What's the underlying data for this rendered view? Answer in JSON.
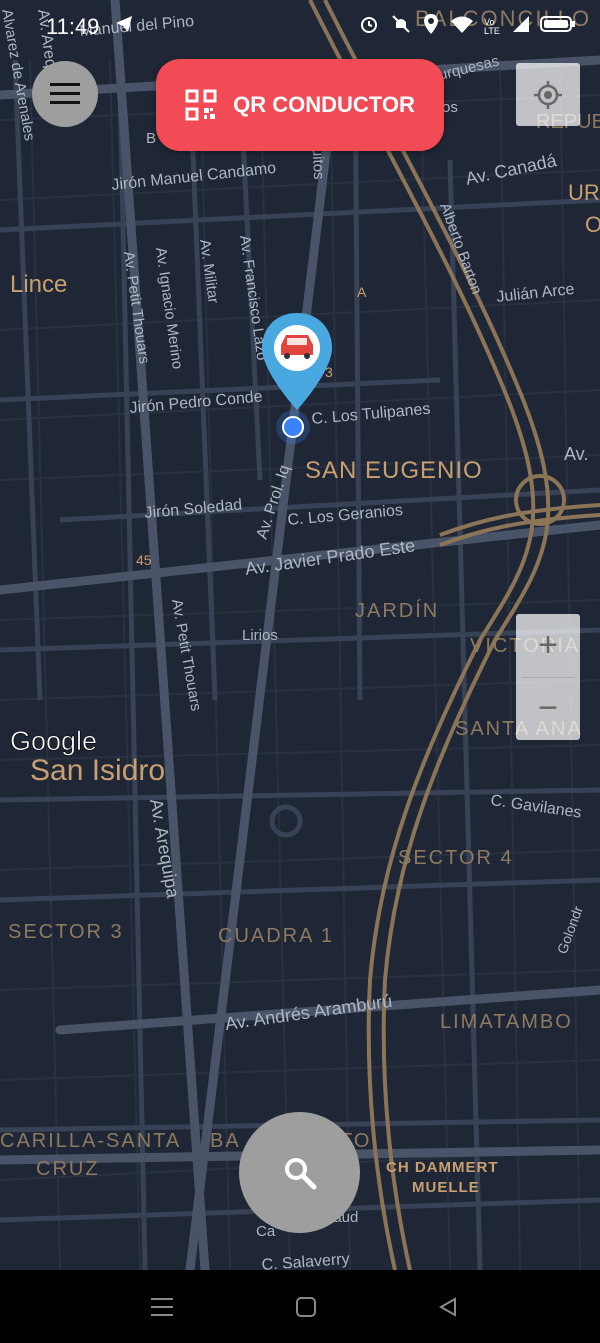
{
  "status_bar": {
    "time": "11:49",
    "icons": [
      "telegram-icon",
      "alarm-icon",
      "mute-icon",
      "location-icon",
      "wifi-icon",
      "volte-icon",
      "signal-icon",
      "battery-icon"
    ],
    "volte_label": "Vo LTE"
  },
  "buttons": {
    "qr_label": "QR CONDUCTOR",
    "zoom_in": "+",
    "zoom_out": "−"
  },
  "map": {
    "attribution": "Google",
    "neighborhoods": [
      "Lince",
      "San Isidro",
      "SAN EUGENIO",
      "JARDÍN",
      "VICTORIA",
      "SANTA ANA",
      "SECTOR 4",
      "SECTOR 3",
      "CUADRA 1",
      "LIMATAMBO",
      "CARILLA-SANTA",
      "CRUZ",
      "BA",
      "TO",
      "CH DAMMERT",
      "MUELLE",
      "BALCONCILLO",
      "REPUBLICA",
      "UR",
      "O"
    ],
    "streets": [
      "Manuel del Pino",
      "Av. Arequipa",
      "Alvarez de Arenales",
      "Jirón Manuel Candamo",
      "Av. Canadá",
      "Alberto Barton",
      "Julián Arce",
      "Av. Petit Thouars",
      "Av. Ignacio Merino",
      "Av. Militar",
      "Av. Francisco Lazo",
      "Jirón Pedro Conde",
      "C. Los Tulipanes",
      "Jirón Soledad",
      "C. Los Geranios",
      "Av. Prol. Iq",
      "Av. Javier Prado Este",
      "Av. Petit Thouars",
      "Lirios",
      "Av. Arequipa",
      "C. Gavilanes",
      "Av. Andrés Aramburú",
      "Av.",
      "Golondr",
      "C. Salaverry",
      "Ca",
      "laud",
      "urquesas",
      "os",
      "B",
      "uitos",
      "A",
      "45",
      "3"
    ]
  },
  "colors": {
    "map_bg": "#1f2635",
    "block": "#2b3444",
    "minor_road": "#384257",
    "major_road": "#4a5468",
    "highway": "#8c7556",
    "label_orange": "#c8a070",
    "label_light": "#aeb6c4",
    "qr_button": "#f24b55",
    "pin_blue": "#4aa8e0",
    "car_red": "#e2453f",
    "location_dot": "#3a82f7"
  }
}
